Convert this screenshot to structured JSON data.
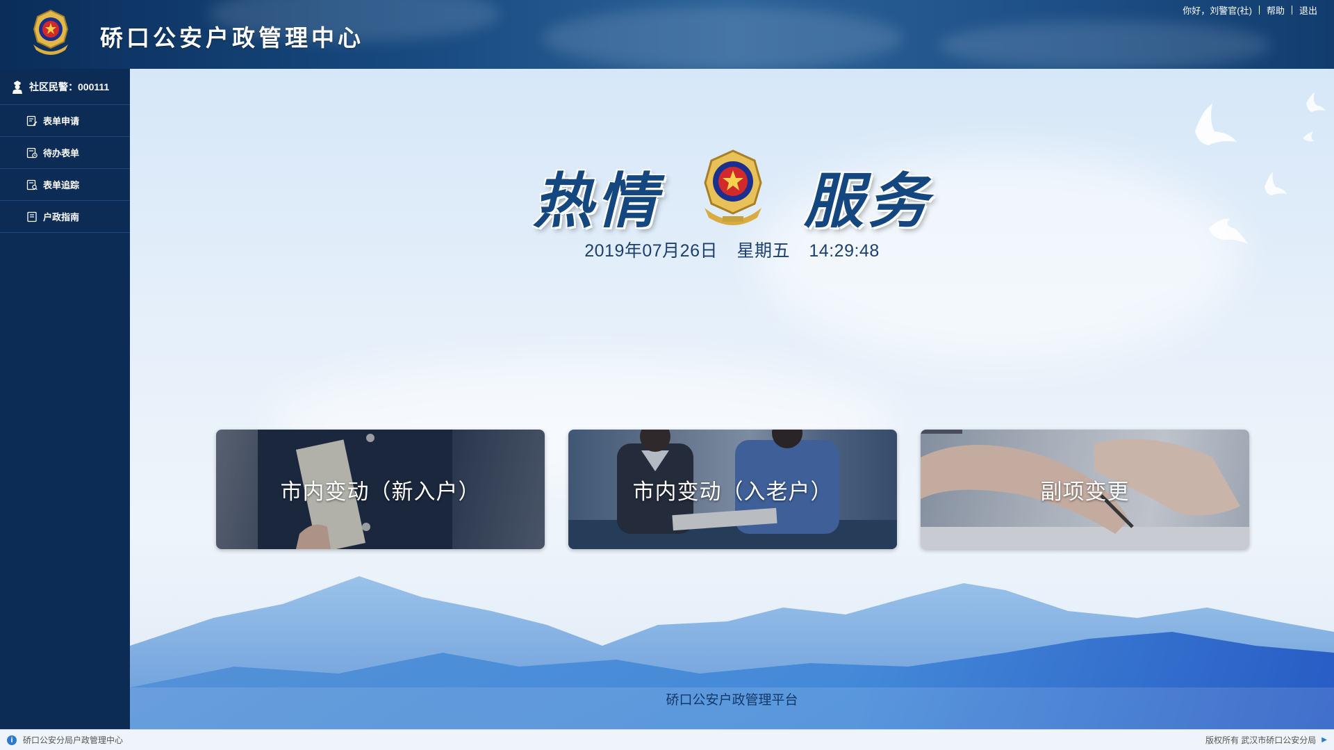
{
  "app": {
    "title": "硚口公安户政管理中心"
  },
  "topbar": {
    "greeting": "你好，刘警官(社)",
    "help": "帮助",
    "logout": "退出"
  },
  "sidebar": {
    "user_label": "社区民警：000111",
    "items": [
      {
        "label": "表单申请",
        "icon": "form-edit-icon"
      },
      {
        "label": "待办表单",
        "icon": "pending-form-icon"
      },
      {
        "label": "表单追踪",
        "icon": "form-track-icon"
      },
      {
        "label": "户政指南",
        "icon": "guide-icon"
      }
    ]
  },
  "slogan": {
    "left": "热情",
    "right": "服务"
  },
  "datetime": {
    "date": "2019年07月26日",
    "weekday": "星期五",
    "time": "14:29:48"
  },
  "cards": [
    {
      "label": "市内变动（新入户）"
    },
    {
      "label": "市内变动（入老户）"
    },
    {
      "label": "副项变更"
    }
  ],
  "footer": {
    "platform": "硚口公安户政管理平台"
  },
  "statusbar": {
    "left": "硚口公安分局户政管理中心",
    "right": "版权所有 武汉市硚口公安分局"
  },
  "colors": {
    "sidebar_bg": "#0c2b55",
    "header_bg": "#17497f",
    "text_dark_blue": "#1c3f6e"
  }
}
